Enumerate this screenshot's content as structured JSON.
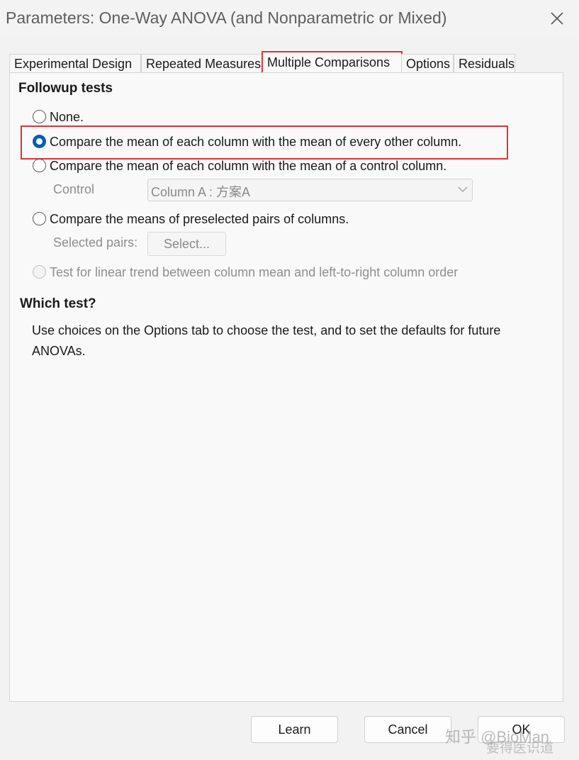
{
  "window": {
    "title": "Parameters: One-Way ANOVA (and Nonparametric or Mixed)",
    "close_icon": "close-icon"
  },
  "tabs": [
    {
      "label": "Experimental Design",
      "active": false
    },
    {
      "label": "Repeated Measures",
      "active": false
    },
    {
      "label": "Multiple Comparisons",
      "active": true
    },
    {
      "label": "Options",
      "active": false
    },
    {
      "label": "Residuals",
      "active": false
    }
  ],
  "followup": {
    "heading": "Followup tests",
    "options": [
      {
        "label": "None.",
        "checked": false,
        "enabled": true
      },
      {
        "label": "Compare the mean of each column with the mean of every other column.",
        "checked": true,
        "enabled": true
      },
      {
        "label": "Compare the mean of each column with the mean of a control column.",
        "checked": false,
        "enabled": true
      },
      {
        "label": "Compare the means of preselected pairs of columns.",
        "checked": false,
        "enabled": true
      },
      {
        "label": "Test for linear trend between column mean and left-to-right column order",
        "checked": false,
        "enabled": false
      }
    ],
    "control_label": "Control",
    "control_value": "Column A : 方案A",
    "pairs_label": "Selected pairs:",
    "select_button": "Select..."
  },
  "which_test": {
    "heading": "Which test?",
    "description": "Use choices on the Options tab to choose the test, and to set the defaults for future ANOVAs."
  },
  "buttons": {
    "learn": "Learn",
    "cancel": "Cancel",
    "ok": "OK"
  },
  "watermark": {
    "line1": "知乎 @BioMan",
    "line2": "要得医识道"
  },
  "colors": {
    "highlight": "#d8353a",
    "radio_checked": "#0a5cb5"
  }
}
